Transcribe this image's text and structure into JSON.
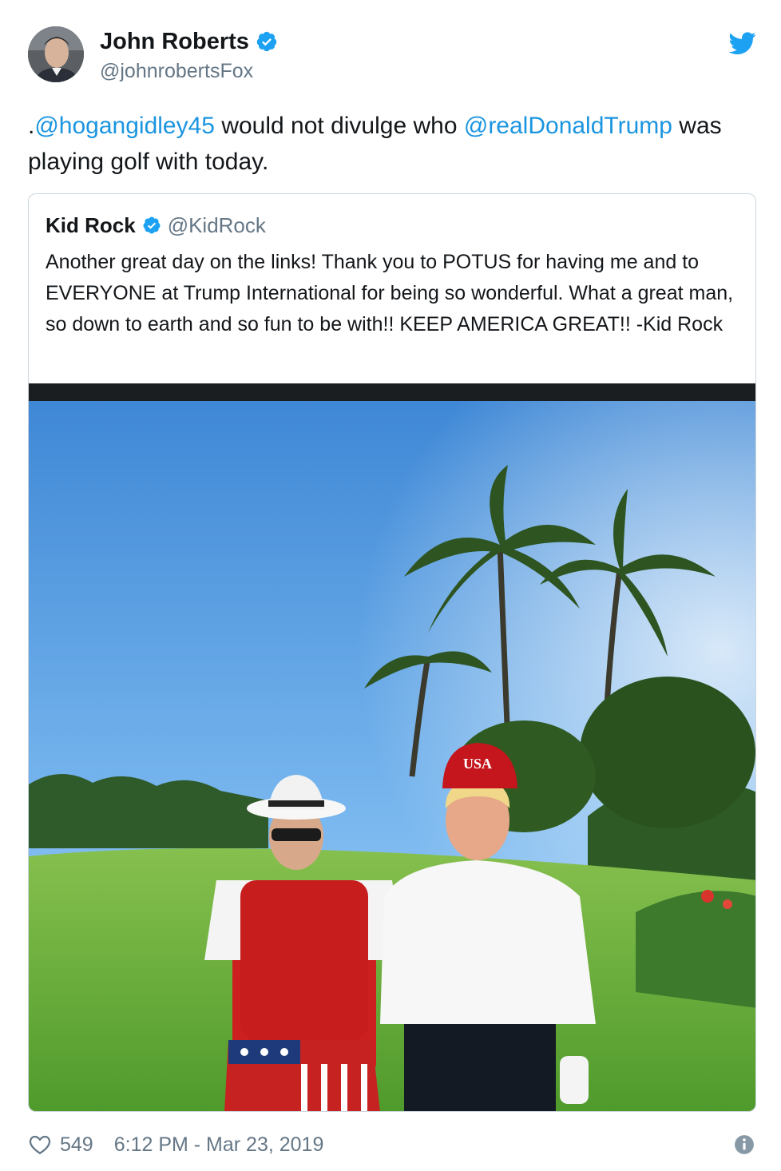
{
  "author": {
    "name": "John Roberts",
    "handle": "@johnrobertsFox",
    "verified": true,
    "avatar_icon": "avatar"
  },
  "tweet": {
    "prefix": ".",
    "mention1": "@hogangidley45",
    "middle": " would not divulge who ",
    "mention2": "@realDonaldTrump",
    "suffix": " was playing golf with today."
  },
  "quoted": {
    "name": "Kid Rock",
    "handle": "@KidRock",
    "text": "Another great day on the links! Thank you to POTUS for having me and to EVERYONE at Trump International for being so wonderful. What a great man, so down to earth and so fun to be with!! KEEP AMERICA GREAT!! -Kid Rock",
    "photo_hat_text": "USA"
  },
  "footer": {
    "likes": "549",
    "timestamp": "6:12 PM - Mar 23, 2019"
  },
  "colors": {
    "link": "#1b95e0",
    "twitter_blue": "#1da1f2",
    "muted": "#657786",
    "border": "#ccd6dd"
  }
}
